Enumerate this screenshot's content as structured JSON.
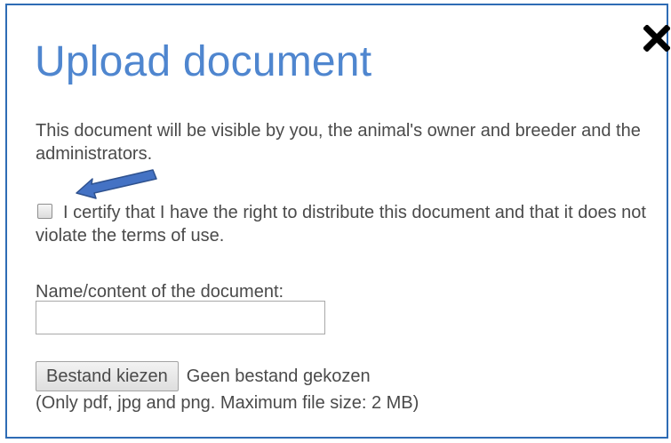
{
  "dialog": {
    "title": "Upload document",
    "notice": "This document will be visible by you, the animal's owner and breeder and the administrators.",
    "certify": {
      "label": "I certify that I have the right to distribute this document and that it does not violate the terms of use.",
      "checked": false
    },
    "name_field": {
      "label": "Name/content of the document:",
      "value": "",
      "placeholder": ""
    },
    "file": {
      "button_label": "Bestand kiezen",
      "status": "Geen bestand gekozen",
      "hint": "(Only pdf, jpg and png. Maximum file size: 2 MB)"
    }
  },
  "icons": {
    "close": "close-icon",
    "annotation": "arrow-annotation-icon"
  },
  "colors": {
    "border": "#2e6cb5",
    "title": "#4f86cf",
    "text": "#4a4a4a",
    "arrow_fill": "#4472c4",
    "arrow_stroke": "#2f528f"
  }
}
